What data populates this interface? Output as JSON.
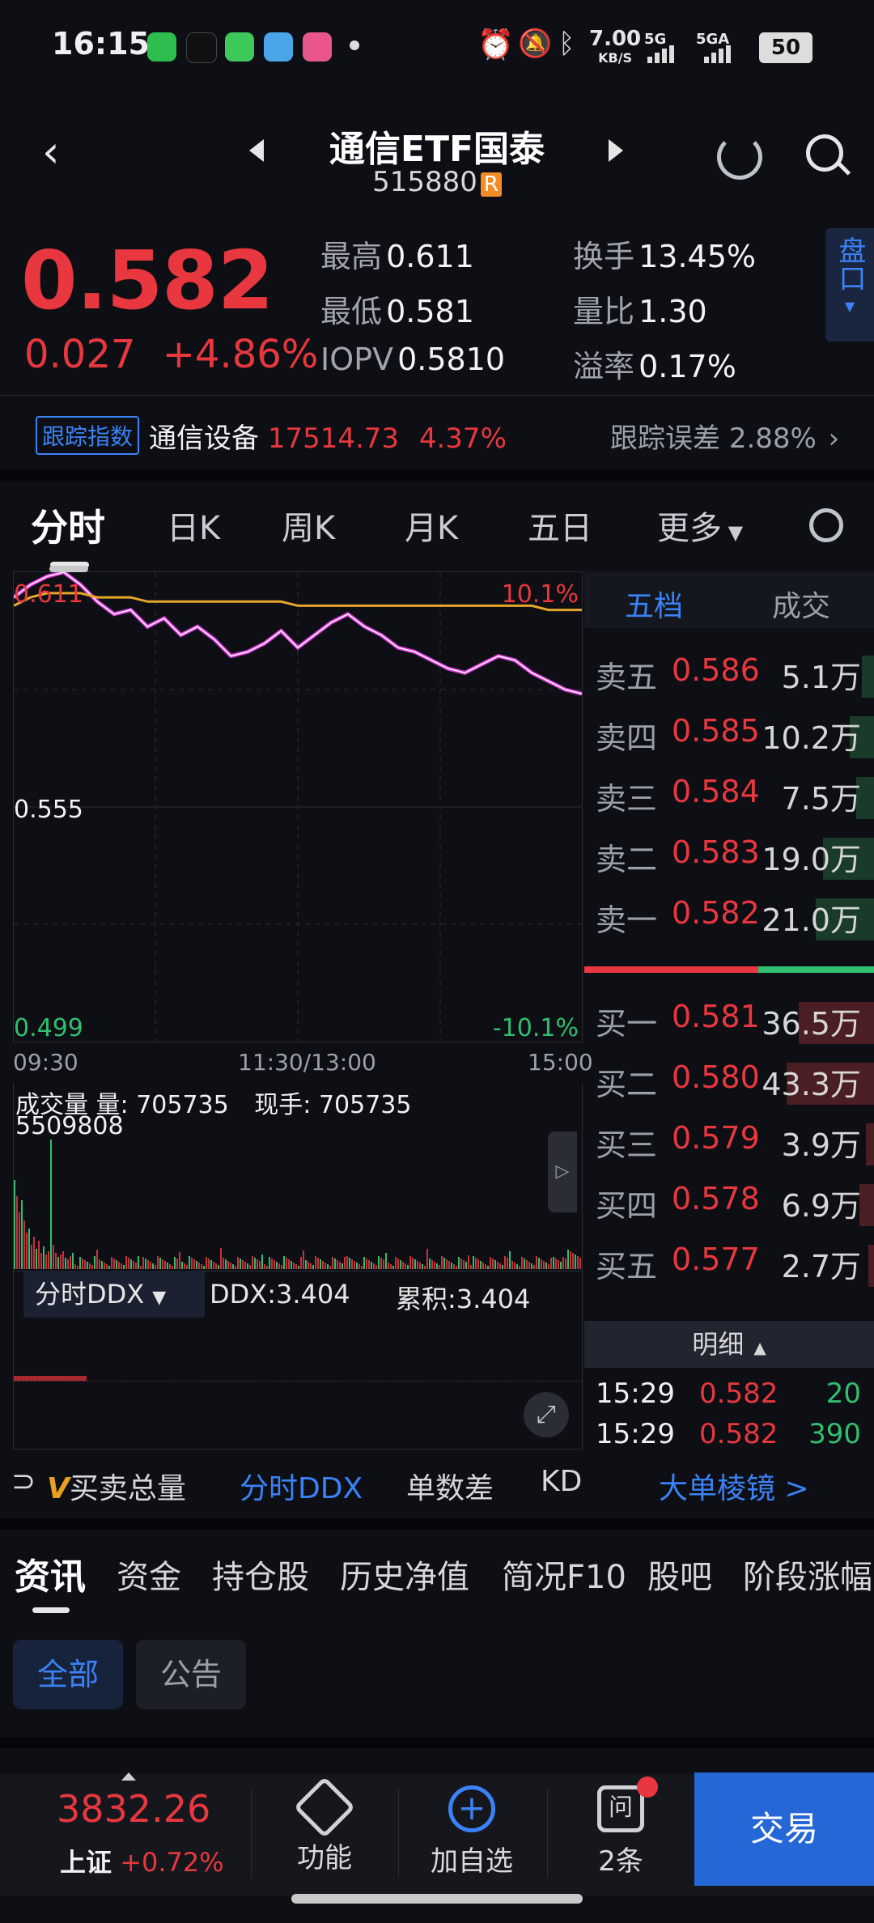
{
  "status_bar": {
    "time": "16:15",
    "net_speed": "7.00",
    "net_unit": "KB/S",
    "sig1": "5G",
    "sig2": "5GA",
    "battery": "50"
  },
  "header": {
    "title": "通信ETF国泰",
    "code": "515880",
    "badge": "R"
  },
  "quote": {
    "price": "0.582",
    "change": "0.027",
    "change_pct": "+4.86%",
    "stats": [
      {
        "label": "最高",
        "value": "0.611"
      },
      {
        "label": "最低",
        "value": "0.581"
      },
      {
        "label": "IOPV",
        "value": "0.5810"
      },
      {
        "label": "换手",
        "value": "13.45%"
      },
      {
        "label": "量比",
        "value": "1.30"
      },
      {
        "label": "溢率",
        "value": "0.17%"
      }
    ],
    "pankou_label": "盘口"
  },
  "tracking": {
    "badge": "跟踪指数",
    "index_name": "通信设备",
    "index_value": "17514.73",
    "index_pct": "4.37%",
    "error_label": "跟踪误差",
    "error_value": "2.88%"
  },
  "chart_tabs": [
    "分时",
    "日K",
    "周K",
    "月K",
    "五日",
    "更多"
  ],
  "chart": {
    "price_high": "0.611",
    "price_mid": "0.555",
    "price_low": "0.499",
    "pct_high": "10.1%",
    "pct_low": "-10.1%",
    "times": [
      "09:30",
      "11:30/13:00",
      "15:00"
    ]
  },
  "chart_data": {
    "type": "line",
    "x_axis": [
      "09:30",
      "11:30/13:00",
      "15:00"
    ],
    "ylim": [
      0.499,
      0.611
    ],
    "series": [
      {
        "name": "price",
        "values": [
          0.605,
          0.608,
          0.61,
          0.611,
          0.608,
          0.604,
          0.601,
          0.602,
          0.598,
          0.6,
          0.596,
          0.598,
          0.595,
          0.591,
          0.592,
          0.594,
          0.597,
          0.593,
          0.596,
          0.599,
          0.601,
          0.598,
          0.596,
          0.593,
          0.592,
          0.59,
          0.588,
          0.587,
          0.589,
          0.591,
          0.59,
          0.587,
          0.585,
          0.583,
          0.582
        ]
      },
      {
        "name": "avg",
        "values": [
          0.603,
          0.605,
          0.606,
          0.606,
          0.606,
          0.605,
          0.605,
          0.605,
          0.604,
          0.604,
          0.604,
          0.604,
          0.604,
          0.604,
          0.604,
          0.604,
          0.604,
          0.603,
          0.603,
          0.603,
          0.603,
          0.603,
          0.603,
          0.603,
          0.603,
          0.603,
          0.603,
          0.603,
          0.603,
          0.603,
          0.603,
          0.603,
          0.602,
          0.602,
          0.602
        ]
      }
    ]
  },
  "volume": {
    "label": "成交量",
    "amount_label": "量:",
    "amount": "705735",
    "hand_label": "现手:",
    "hand": "705735",
    "max": "5509808"
  },
  "ddx": {
    "select": "分时DDX",
    "ddx": "DDX:3.404",
    "cum": "累积:3.404"
  },
  "orderbook": {
    "tab_active": "五档",
    "tab_other": "成交",
    "sell": [
      {
        "label": "卖五",
        "price": "0.586",
        "vol": "5.1万",
        "bar": 0.1
      },
      {
        "label": "卖四",
        "price": "0.585",
        "vol": "10.2万",
        "bar": 0.2
      },
      {
        "label": "卖三",
        "price": "0.584",
        "vol": "7.5万",
        "bar": 0.15
      },
      {
        "label": "卖二",
        "price": "0.583",
        "vol": "19.0万",
        "bar": 0.42
      },
      {
        "label": "卖一",
        "price": "0.582",
        "vol": "21.0万",
        "bar": 0.48
      }
    ],
    "buy": [
      {
        "label": "买一",
        "price": "0.581",
        "vol": "36.5万",
        "bar": 0.62
      },
      {
        "label": "买二",
        "price": "0.580",
        "vol": "43.3万",
        "bar": 0.72
      },
      {
        "label": "买三",
        "price": "0.579",
        "vol": "3.9万",
        "bar": 0.07
      },
      {
        "label": "买四",
        "price": "0.578",
        "vol": "6.9万",
        "bar": 0.12
      },
      {
        "label": "买五",
        "price": "0.577",
        "vol": "2.7万",
        "bar": 0.05
      }
    ],
    "detail_label": "明细",
    "trades": [
      {
        "time": "15:29",
        "price": "0.582",
        "vol": "20"
      },
      {
        "time": "15:29",
        "price": "0.582",
        "vol": "390"
      }
    ]
  },
  "sub_tabs": {
    "lead": "V",
    "items": [
      "买卖总量",
      "分时DDX",
      "单数差",
      "KD",
      "大单棱镜 >"
    ]
  },
  "news_tabs": [
    "资讯",
    "资金",
    "持仓股",
    "历史净值",
    "简况F10",
    "股吧",
    "阶段涨幅"
  ],
  "filters": [
    "全部",
    "公告"
  ],
  "bottom": {
    "index_value": "3832.26",
    "index_name": "上证",
    "index_pct": "+0.72%",
    "func": "功能",
    "add": "加自选",
    "msg": "2条",
    "trade": "交易"
  }
}
